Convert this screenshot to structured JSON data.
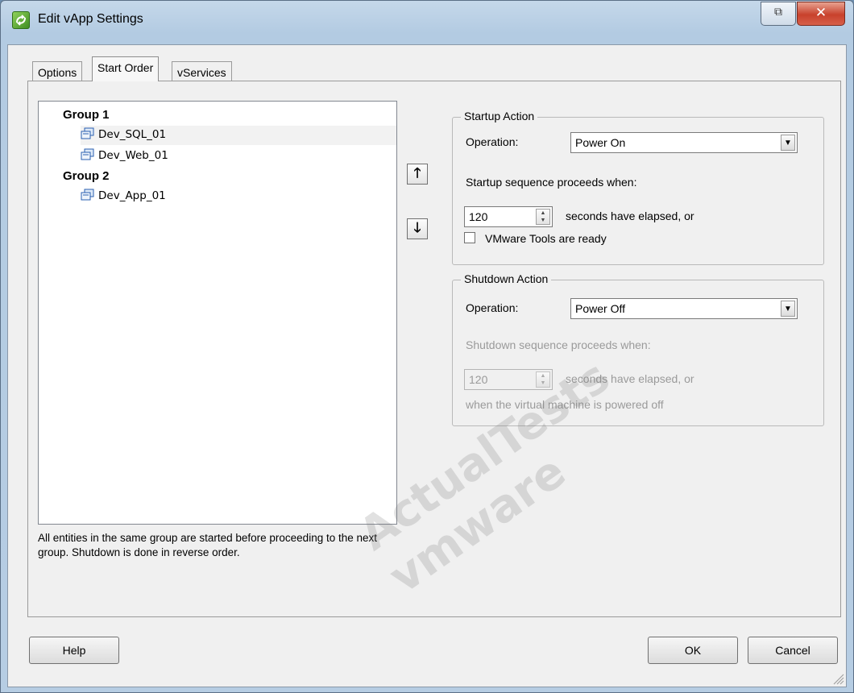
{
  "window": {
    "title": "Edit vApp Settings",
    "restore_glyph": "⧉",
    "close_glyph": "✕"
  },
  "tabs": [
    {
      "label": "Options"
    },
    {
      "label": "Start Order"
    },
    {
      "label": "vServices"
    }
  ],
  "tree": {
    "groups": [
      {
        "label": "Group 1",
        "items": [
          "Dev_SQL_01",
          "Dev_Web_01"
        ]
      },
      {
        "label": "Group 2",
        "items": [
          "Dev_App_01"
        ]
      }
    ],
    "selected": "Dev_SQL_01",
    "icon": "vm-icon"
  },
  "note": "All entities in the same group are started before proceeding to the next group. Shutdown is done in reverse order.",
  "move_buttons": {
    "up": "🡑",
    "down": "🡓"
  },
  "startup": {
    "title": "Startup Action",
    "operation_label": "Operation:",
    "operation_value": "Power On",
    "proceeds_label": "Startup sequence proceeds when:",
    "seconds_value": "120",
    "seconds_label": "seconds have elapsed, or",
    "tools_label": "VMware Tools are ready",
    "tools_checked": false
  },
  "shutdown": {
    "title": "Shutdown Action",
    "operation_label": "Operation:",
    "operation_value": "Power Off",
    "proceeds_label": "Shutdown sequence proceeds when:",
    "seconds_value": "120",
    "seconds_label": "seconds have elapsed, or",
    "powered_off_label": "when the virtual machine is powered off"
  },
  "buttons": {
    "help": "Help",
    "ok": "OK",
    "cancel": "Cancel"
  },
  "watermark": "ActualTests vmware",
  "colors": {
    "title_bar": "#b6cde3",
    "close_button": "#c8412c",
    "dialog_bg": "#f0f0f0"
  }
}
